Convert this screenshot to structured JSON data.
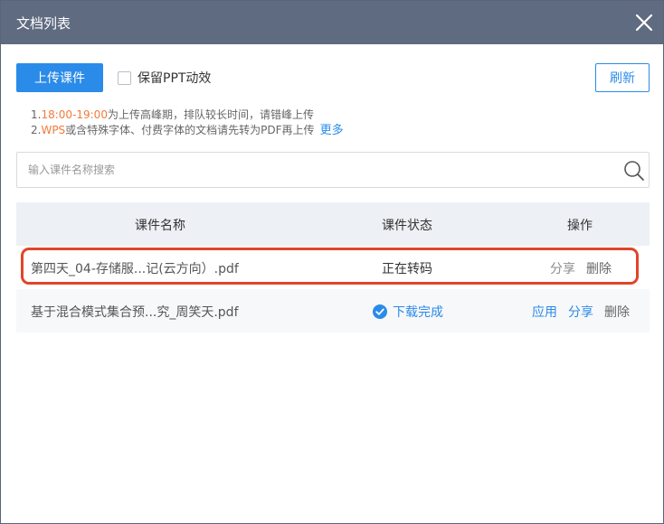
{
  "window": {
    "title": "文档列表"
  },
  "toolbar": {
    "upload_label": "上传课件",
    "keep_ppt_anim_label": "保留PPT动效",
    "keep_ppt_anim_checked": false,
    "refresh_label": "刷新"
  },
  "tips": {
    "line1_prefix": "1.",
    "line1_highlight": "18:00-19:00",
    "line1_text": "为上传高峰期，排队较长时间，请错峰上传",
    "line2_prefix": "2.",
    "line2_highlight": "WPS",
    "line2_text": "或含特殊字体、付费字体的文档请先转为PDF再上传",
    "more_label": "更多"
  },
  "search": {
    "placeholder": "输入课件名称搜索",
    "value": ""
  },
  "table": {
    "headers": {
      "name": "课件名称",
      "status": "课件状态",
      "actions": "操作"
    },
    "rows": [
      {
        "name": "第四天_04-存储服...记(云方向）.pdf",
        "status": "正在转码",
        "actions": [
          "分享",
          "删除"
        ]
      },
      {
        "name": "基于混合模式集合预...究_周笑天.pdf",
        "status": "下载完成",
        "actions": [
          "应用",
          "分享",
          "删除"
        ]
      }
    ]
  },
  "colors": {
    "accent": "#2b8be8",
    "titlebar": "#5f6b80",
    "highlight_border": "#e0452a",
    "tip_highlight": "#f27a3a"
  }
}
